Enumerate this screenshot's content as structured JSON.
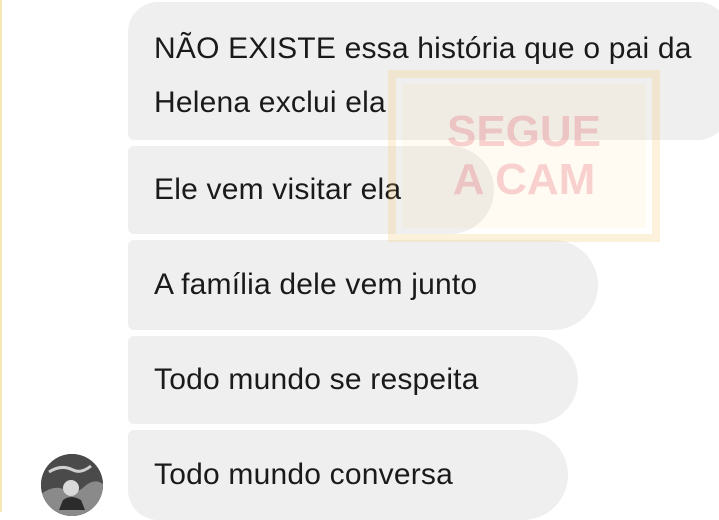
{
  "messages": [
    {
      "text": "NÃO EXISTE essa história que o pai da Helena exclui ela"
    },
    {
      "text": "Ele vem visitar ela"
    },
    {
      "text": "A família dele vem junto"
    },
    {
      "text": "Todo mundo se respeita"
    },
    {
      "text": "Todo mundo conversa"
    }
  ],
  "watermark": {
    "line1": "SEGUE",
    "line2": "A CAM",
    "colors": {
      "frame": "#f6c35c",
      "fill": "#e2322a"
    }
  },
  "colors": {
    "bubble": "#efefef",
    "text": "#1a1a1a",
    "background": "#ffffff"
  },
  "avatar": {
    "icon": "profile-avatar"
  }
}
